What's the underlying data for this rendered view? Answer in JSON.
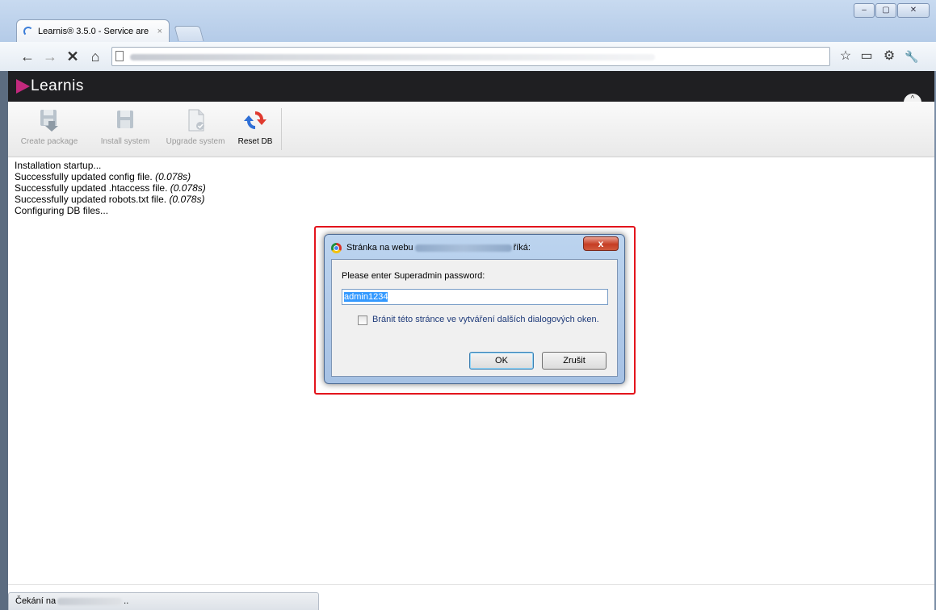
{
  "browser": {
    "tab_title": "Learnis® 3.5.0 - Service are",
    "tab_close": "×",
    "window_controls": {
      "minimize": "–",
      "maximize": "▢",
      "close": "✕"
    },
    "nav": {
      "back": "←",
      "forward": "→",
      "stop": "✕",
      "home": "⌂"
    },
    "toolbar_right": {
      "star": "☆",
      "page": "▭",
      "settings": "⚙",
      "wrench": "🔧"
    }
  },
  "app": {
    "logo_text": "Learnis",
    "toolbar": [
      {
        "label": "Create package",
        "enabled": false
      },
      {
        "label": "Install system",
        "enabled": false
      },
      {
        "label": "Upgrade system",
        "enabled": false
      },
      {
        "label": "Reset DB",
        "enabled": true
      }
    ],
    "collapse_icon": "^"
  },
  "log": {
    "lines": [
      {
        "text": "Installation startup...",
        "time": ""
      },
      {
        "text": "Successfully updated config file. ",
        "time": "(0.078s)"
      },
      {
        "text": "Successfully updated .htaccess file. ",
        "time": "(0.078s)"
      },
      {
        "text": "Successfully updated robots.txt file. ",
        "time": "(0.078s)"
      },
      {
        "text": "Configuring DB files...",
        "time": ""
      }
    ]
  },
  "dialog": {
    "title_prefix": "Stránka na webu",
    "title_suffix": "říká:",
    "close_label": "x",
    "prompt": "Please enter Superadmin password:",
    "input_value": "admin1234",
    "checkbox_label": "Bránit této stránce ve vytváření dalších dialogových oken.",
    "ok_label": "OK",
    "cancel_label": "Zrušit",
    "highlight_color": "#e3141c"
  },
  "status": {
    "prefix": "Čekání na",
    "suffix": ".."
  }
}
